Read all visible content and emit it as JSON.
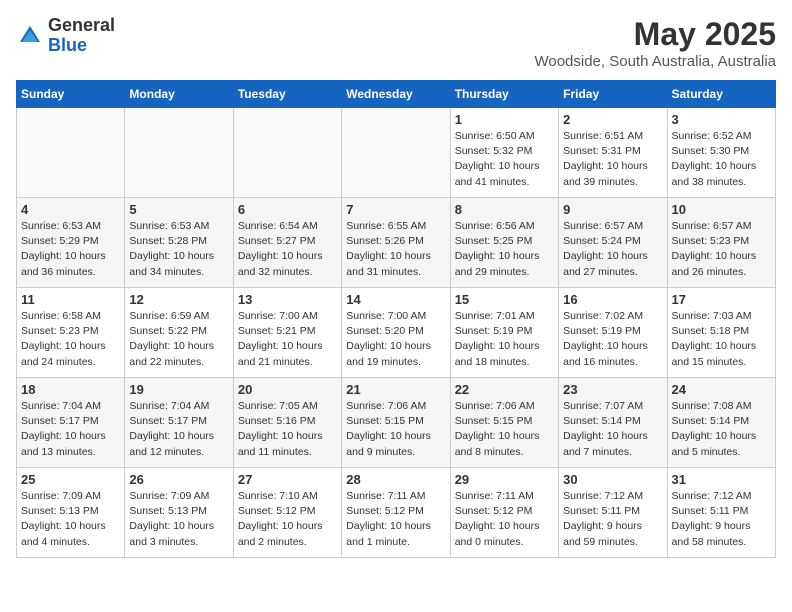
{
  "header": {
    "logo_line1": "General",
    "logo_line2": "Blue",
    "main_title": "May 2025",
    "subtitle": "Woodside, South Australia, Australia"
  },
  "weekdays": [
    "Sunday",
    "Monday",
    "Tuesday",
    "Wednesday",
    "Thursday",
    "Friday",
    "Saturday"
  ],
  "weeks": [
    [
      {
        "num": "",
        "detail": ""
      },
      {
        "num": "",
        "detail": ""
      },
      {
        "num": "",
        "detail": ""
      },
      {
        "num": "",
        "detail": ""
      },
      {
        "num": "1",
        "detail": "Sunrise: 6:50 AM\nSunset: 5:32 PM\nDaylight: 10 hours\nand 41 minutes."
      },
      {
        "num": "2",
        "detail": "Sunrise: 6:51 AM\nSunset: 5:31 PM\nDaylight: 10 hours\nand 39 minutes."
      },
      {
        "num": "3",
        "detail": "Sunrise: 6:52 AM\nSunset: 5:30 PM\nDaylight: 10 hours\nand 38 minutes."
      }
    ],
    [
      {
        "num": "4",
        "detail": "Sunrise: 6:53 AM\nSunset: 5:29 PM\nDaylight: 10 hours\nand 36 minutes."
      },
      {
        "num": "5",
        "detail": "Sunrise: 6:53 AM\nSunset: 5:28 PM\nDaylight: 10 hours\nand 34 minutes."
      },
      {
        "num": "6",
        "detail": "Sunrise: 6:54 AM\nSunset: 5:27 PM\nDaylight: 10 hours\nand 32 minutes."
      },
      {
        "num": "7",
        "detail": "Sunrise: 6:55 AM\nSunset: 5:26 PM\nDaylight: 10 hours\nand 31 minutes."
      },
      {
        "num": "8",
        "detail": "Sunrise: 6:56 AM\nSunset: 5:25 PM\nDaylight: 10 hours\nand 29 minutes."
      },
      {
        "num": "9",
        "detail": "Sunrise: 6:57 AM\nSunset: 5:24 PM\nDaylight: 10 hours\nand 27 minutes."
      },
      {
        "num": "10",
        "detail": "Sunrise: 6:57 AM\nSunset: 5:23 PM\nDaylight: 10 hours\nand 26 minutes."
      }
    ],
    [
      {
        "num": "11",
        "detail": "Sunrise: 6:58 AM\nSunset: 5:23 PM\nDaylight: 10 hours\nand 24 minutes."
      },
      {
        "num": "12",
        "detail": "Sunrise: 6:59 AM\nSunset: 5:22 PM\nDaylight: 10 hours\nand 22 minutes."
      },
      {
        "num": "13",
        "detail": "Sunrise: 7:00 AM\nSunset: 5:21 PM\nDaylight: 10 hours\nand 21 minutes."
      },
      {
        "num": "14",
        "detail": "Sunrise: 7:00 AM\nSunset: 5:20 PM\nDaylight: 10 hours\nand 19 minutes."
      },
      {
        "num": "15",
        "detail": "Sunrise: 7:01 AM\nSunset: 5:19 PM\nDaylight: 10 hours\nand 18 minutes."
      },
      {
        "num": "16",
        "detail": "Sunrise: 7:02 AM\nSunset: 5:19 PM\nDaylight: 10 hours\nand 16 minutes."
      },
      {
        "num": "17",
        "detail": "Sunrise: 7:03 AM\nSunset: 5:18 PM\nDaylight: 10 hours\nand 15 minutes."
      }
    ],
    [
      {
        "num": "18",
        "detail": "Sunrise: 7:04 AM\nSunset: 5:17 PM\nDaylight: 10 hours\nand 13 minutes."
      },
      {
        "num": "19",
        "detail": "Sunrise: 7:04 AM\nSunset: 5:17 PM\nDaylight: 10 hours\nand 12 minutes."
      },
      {
        "num": "20",
        "detail": "Sunrise: 7:05 AM\nSunset: 5:16 PM\nDaylight: 10 hours\nand 11 minutes."
      },
      {
        "num": "21",
        "detail": "Sunrise: 7:06 AM\nSunset: 5:15 PM\nDaylight: 10 hours\nand 9 minutes."
      },
      {
        "num": "22",
        "detail": "Sunrise: 7:06 AM\nSunset: 5:15 PM\nDaylight: 10 hours\nand 8 minutes."
      },
      {
        "num": "23",
        "detail": "Sunrise: 7:07 AM\nSunset: 5:14 PM\nDaylight: 10 hours\nand 7 minutes."
      },
      {
        "num": "24",
        "detail": "Sunrise: 7:08 AM\nSunset: 5:14 PM\nDaylight: 10 hours\nand 5 minutes."
      }
    ],
    [
      {
        "num": "25",
        "detail": "Sunrise: 7:09 AM\nSunset: 5:13 PM\nDaylight: 10 hours\nand 4 minutes."
      },
      {
        "num": "26",
        "detail": "Sunrise: 7:09 AM\nSunset: 5:13 PM\nDaylight: 10 hours\nand 3 minutes."
      },
      {
        "num": "27",
        "detail": "Sunrise: 7:10 AM\nSunset: 5:12 PM\nDaylight: 10 hours\nand 2 minutes."
      },
      {
        "num": "28",
        "detail": "Sunrise: 7:11 AM\nSunset: 5:12 PM\nDaylight: 10 hours\nand 1 minute."
      },
      {
        "num": "29",
        "detail": "Sunrise: 7:11 AM\nSunset: 5:12 PM\nDaylight: 10 hours\nand 0 minutes."
      },
      {
        "num": "30",
        "detail": "Sunrise: 7:12 AM\nSunset: 5:11 PM\nDaylight: 9 hours\nand 59 minutes."
      },
      {
        "num": "31",
        "detail": "Sunrise: 7:12 AM\nSunset: 5:11 PM\nDaylight: 9 hours\nand 58 minutes."
      }
    ]
  ]
}
